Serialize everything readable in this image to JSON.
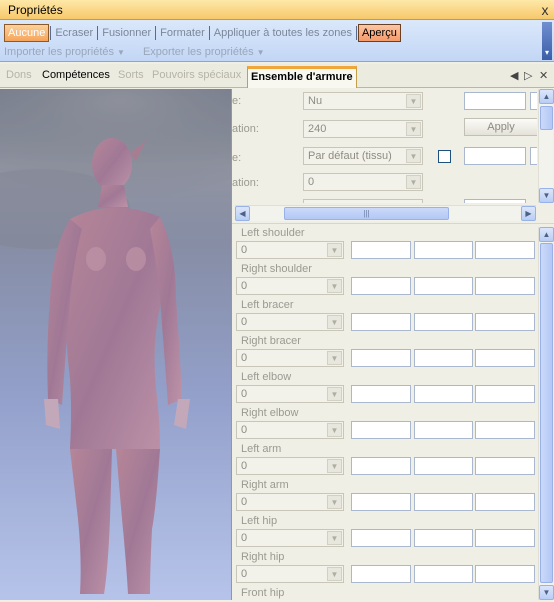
{
  "window": {
    "title": "Propriétés",
    "close_glyph": "x"
  },
  "toolbar": {
    "buttons": [
      "Aucune",
      "Ecraser",
      "Fusionner",
      "Formater",
      "Appliquer à toutes les zones",
      "Aperçu"
    ],
    "menus": [
      "Importer les propriétés",
      "Exporter les propriétés"
    ],
    "dropdown_glyph": "▼"
  },
  "tabs": {
    "items": [
      "Dons",
      "Compétences",
      "Sorts",
      "Pouvoirs spéciaux",
      "Ensemble d'armure"
    ],
    "selected": "Ensemble d'armure",
    "controls": [
      "◀",
      "▷",
      "✕"
    ]
  },
  "props": {
    "rows": [
      {
        "label": "e:",
        "value": "Nu"
      },
      {
        "label": "ation:",
        "value": "240"
      },
      {
        "label": "e:",
        "value": "Par défaut (tissu)"
      },
      {
        "label": "ation:",
        "value": "0"
      }
    ],
    "apply_label": "Apply",
    "hscroll_grip": "|||"
  },
  "armor_parts": [
    {
      "label": "Left shoulder",
      "value": "0"
    },
    {
      "label": "Right shoulder",
      "value": "0"
    },
    {
      "label": "Left bracer",
      "value": "0"
    },
    {
      "label": "Right bracer",
      "value": "0"
    },
    {
      "label": "Left elbow",
      "value": "0"
    },
    {
      "label": "Right elbow",
      "value": "0"
    },
    {
      "label": "Left arm",
      "value": "0"
    },
    {
      "label": "Right arm",
      "value": "0"
    },
    {
      "label": "Left hip",
      "value": "0"
    },
    {
      "label": "Right hip",
      "value": "0"
    },
    {
      "label": "Front hip",
      "value": ""
    }
  ],
  "colors": {
    "title_bar": "#f7c86b",
    "toolbar": "#c2d6f5",
    "selected_tab_accent": "#f0a63a",
    "scrollbar": "#b9cdf4",
    "sky_top": "#6a6e77",
    "sky_bottom": "#b9c5ea"
  }
}
